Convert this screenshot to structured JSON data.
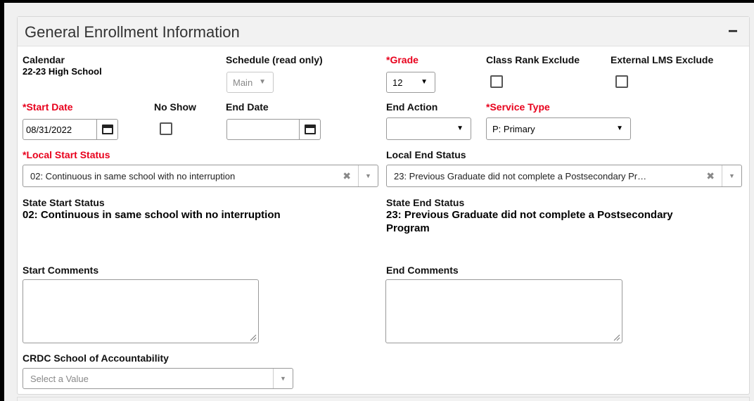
{
  "panel": {
    "title": "General Enrollment Information",
    "collapse_symbol": "−"
  },
  "calendar": {
    "label": "Calendar",
    "value": "22-23 High School"
  },
  "schedule": {
    "label": "Schedule (read only)",
    "value": "Main"
  },
  "grade": {
    "required_mark": "*",
    "label": "Grade",
    "value": "12"
  },
  "class_rank_exclude": {
    "label": "Class Rank Exclude",
    "checked": false
  },
  "external_lms_exclude": {
    "label": "External LMS Exclude",
    "checked": false
  },
  "start_date": {
    "required_mark": "*",
    "label": "Start Date",
    "value": "08/31/2022"
  },
  "no_show": {
    "label": "No Show",
    "checked": false
  },
  "end_date": {
    "label": "End Date",
    "value": ""
  },
  "end_action": {
    "label": "End Action",
    "value": ""
  },
  "service_type": {
    "required_mark": "*",
    "label": "Service Type",
    "value": "P: Primary"
  },
  "local_start_status": {
    "required_mark": "*",
    "label": "Local Start Status",
    "value": "02: Continuous in same school with no interruption"
  },
  "local_end_status": {
    "label": "Local End Status",
    "value": "23: Previous Graduate did not complete a Postsecondary Pr…"
  },
  "state_start_status": {
    "label": "State Start Status",
    "value": "02: Continuous in same school with no interruption"
  },
  "state_end_status": {
    "label": "State End Status",
    "value_line1": "23: Previous Graduate did not complete a Postsecondary",
    "value_line2": "Program"
  },
  "start_comments": {
    "label": "Start Comments",
    "value": ""
  },
  "end_comments": {
    "label": "End Comments",
    "value": ""
  },
  "crdc": {
    "label": "CRDC School of Accountability",
    "placeholder": "Select a Value"
  },
  "glyphs": {
    "dropdown": "▼",
    "clear": "✖",
    "dropdown_small": "▼"
  },
  "colors": {
    "required": "#e8001c"
  }
}
